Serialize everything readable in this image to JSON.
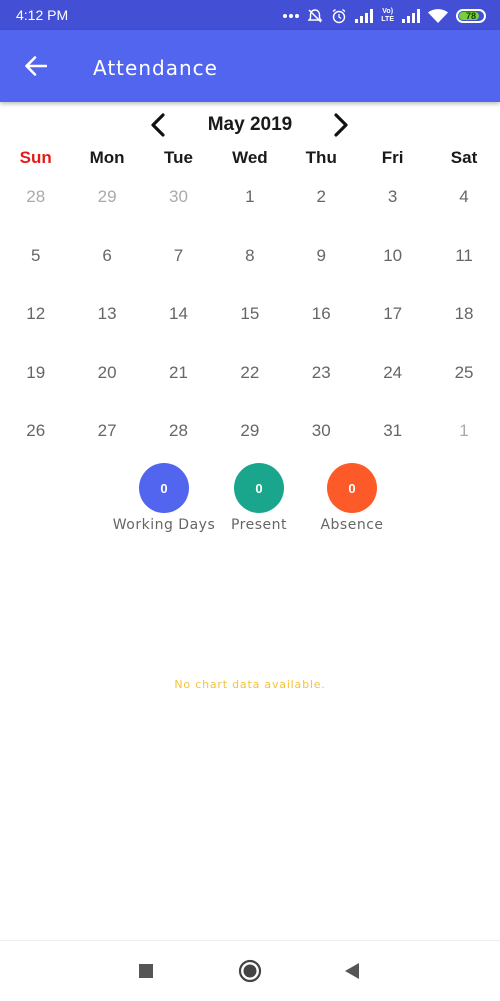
{
  "status_bar": {
    "time": "4:12 PM",
    "volte_top": "Vo)",
    "volte_bottom": "LTE",
    "battery_level": "78",
    "battery_color": "#76d13a",
    "icons": [
      "more-dots-icon",
      "alarm-off-icon",
      "alarm-clock-icon",
      "signal-icon",
      "volte-icon",
      "signal-icon",
      "wifi-icon",
      "battery-icon"
    ]
  },
  "app_bar": {
    "title": "Attendance",
    "back_icon": "arrow-left-icon",
    "color": "#5265ef"
  },
  "calendar": {
    "month_label": "May 2019",
    "prev_icon": "chevron-left-icon",
    "next_icon": "chevron-right-icon",
    "weekdays": [
      "Sun",
      "Mon",
      "Tue",
      "Wed",
      "Thu",
      "Fri",
      "Sat"
    ],
    "sunday_color": "#e21b1b",
    "weeks": [
      [
        "28",
        "29",
        "30",
        "1",
        "2",
        "3",
        "4"
      ],
      [
        "5",
        "6",
        "7",
        "8",
        "9",
        "10",
        "11"
      ],
      [
        "12",
        "13",
        "14",
        "15",
        "16",
        "17",
        "18"
      ],
      [
        "19",
        "20",
        "21",
        "22",
        "23",
        "24",
        "25"
      ],
      [
        "26",
        "27",
        "28",
        "29",
        "30",
        "31",
        "1"
      ]
    ]
  },
  "stats": [
    {
      "label": "Working Days",
      "value": "0",
      "color": "#5265ef"
    },
    {
      "label": "Present",
      "value": "0",
      "color": "#1aa68c"
    },
    {
      "label": "Absence",
      "value": "0",
      "color": "#fd5a2a"
    }
  ],
  "chart": {
    "empty_message": "No chart data available."
  },
  "nav_bar": {
    "icons": [
      "recents-square-icon",
      "home-circle-icon",
      "back-triangle-icon"
    ]
  }
}
